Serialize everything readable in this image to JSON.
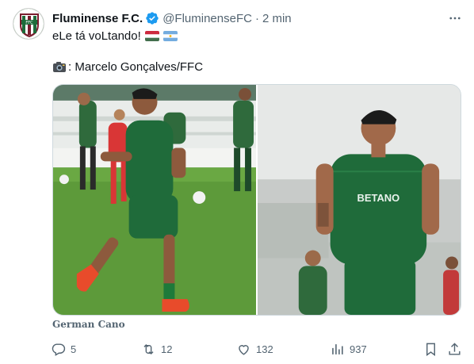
{
  "author": {
    "name": "Fluminense F.C.",
    "handle": "@FluminenseFC",
    "separator": "·",
    "time": "2 min"
  },
  "tweet": {
    "text_line1": "eLe tá voLtando!",
    "photo_credit": ": Marcelo Gonçalves/FFC",
    "flags": [
      "hungary-flag",
      "argentina-flag"
    ]
  },
  "media": {
    "photos": [
      "training-photo-left",
      "training-photo-right"
    ],
    "tagged_person": "German Cano"
  },
  "actions": {
    "replies": "5",
    "retweets": "12",
    "likes": "132",
    "views": "937"
  },
  "colors": {
    "text": "#0f1419",
    "muted": "#536471",
    "verified": "#1d9bf0",
    "border": "#cfd9de",
    "jersey_green": "#1f6b3a",
    "grass": "#5d9a3a"
  }
}
